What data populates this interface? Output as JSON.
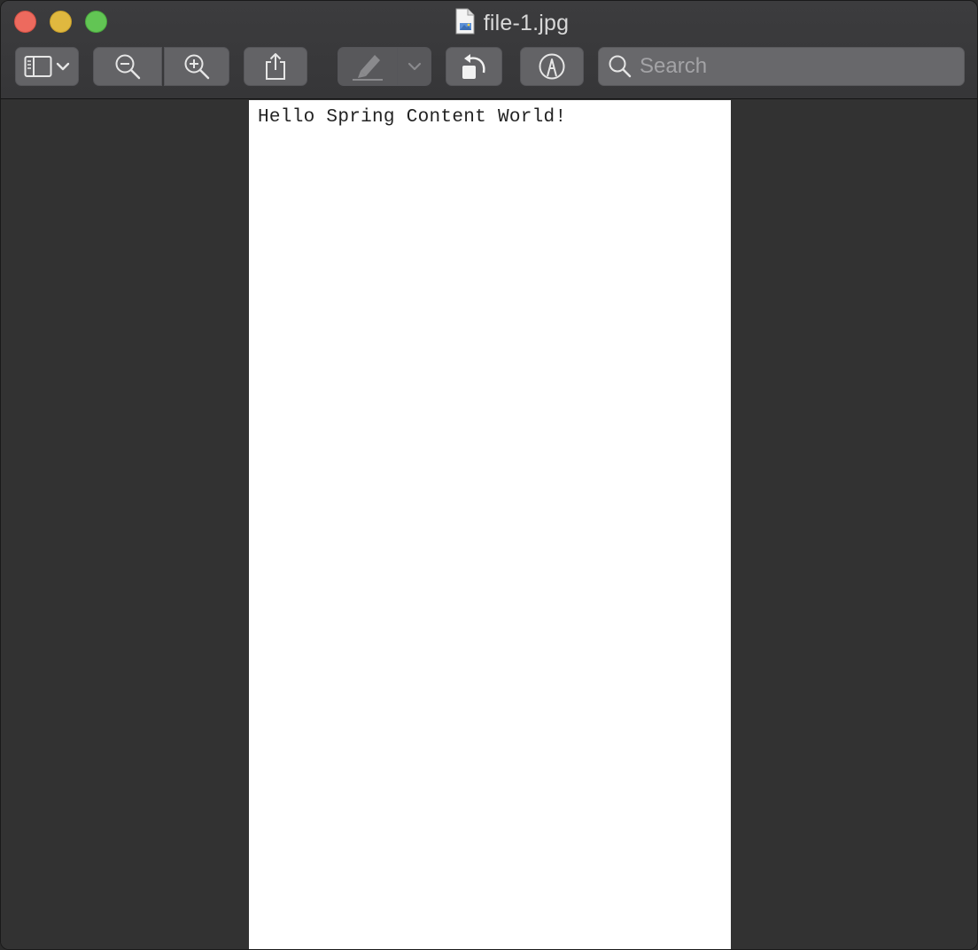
{
  "window": {
    "title": "file-1.jpg",
    "file_icon": "image-file-icon"
  },
  "toolbar": {
    "sidebar_toggle_icon": "sidebar-icon",
    "sidebar_menu_icon": "chevron-down-icon",
    "zoom_out_icon": "zoom-out-icon",
    "zoom_in_icon": "zoom-in-icon",
    "share_icon": "share-icon",
    "highlight_icon": "highlighter-icon",
    "highlight_menu_icon": "chevron-down-icon",
    "rotate_icon": "rotate-left-icon",
    "markup_icon": "markup-pen-icon"
  },
  "search": {
    "placeholder": "Search",
    "value": ""
  },
  "document": {
    "text": "Hello Spring Content World!"
  },
  "colors": {
    "close": "#ed6a5e",
    "minimize": "#e0b83f",
    "maximize": "#62c554",
    "toolbar_button": "#636366",
    "background": "#323232",
    "page": "#ffffff"
  }
}
